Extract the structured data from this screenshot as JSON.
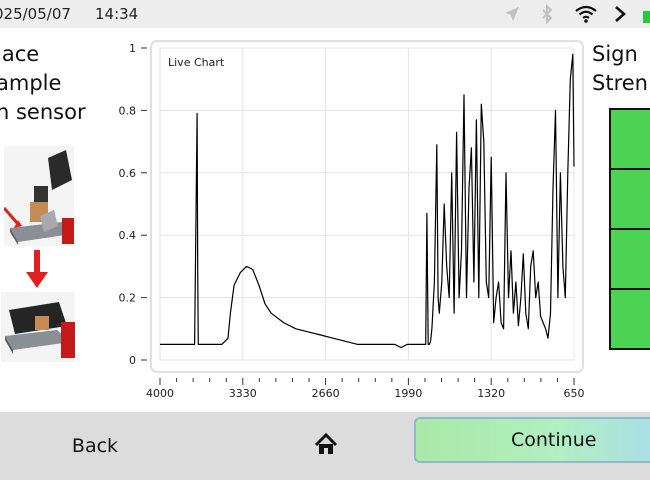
{
  "status_bar": {
    "date": "025/05/07",
    "time": "14:34",
    "icons": [
      "location-icon",
      "bluetooth-icon",
      "wifi-icon",
      "chevron-right-icon",
      "battery-icon"
    ]
  },
  "instructions": {
    "lines": [
      "lace",
      "ample",
      "n sensor"
    ]
  },
  "signal": {
    "title_lines": [
      "Sign",
      "Stren"
    ],
    "bars_filled": 4,
    "bar_color": "#4cd353"
  },
  "bottom_bar": {
    "back_label": "Back",
    "home_icon": "home-icon",
    "continue_label": "Continue"
  },
  "chart_data": {
    "type": "line",
    "title": "Live Chart",
    "xlabel": "",
    "ylabel": "",
    "xlim": [
      4000,
      650
    ],
    "ylim": [
      0,
      1
    ],
    "x_ticks": [
      4000,
      3330,
      2660,
      1990,
      1320,
      650
    ],
    "y_ticks": [
      0,
      0.2,
      0.4,
      0.6,
      0.8,
      1
    ],
    "y_tick_labels": [
      "0",
      "0.2",
      "0.4",
      "0.6",
      "0.8",
      "1"
    ],
    "grid": true,
    "series": [
      {
        "x": [
          4000,
          3900,
          3800,
          3720,
          3700,
          3695,
          3690,
          3680,
          3600,
          3500,
          3450,
          3430,
          3400,
          3350,
          3300,
          3250,
          3200,
          3150,
          3100,
          3000,
          2900,
          2800,
          2700,
          2600,
          2500,
          2400,
          2300,
          2200,
          2150,
          2100,
          2050,
          2000,
          1950,
          1900,
          1850,
          1840,
          1830,
          1825,
          1820,
          1810,
          1800,
          1780,
          1760,
          1750,
          1740,
          1720,
          1700,
          1680,
          1660,
          1640,
          1620,
          1600,
          1580,
          1560,
          1540,
          1520,
          1500,
          1480,
          1460,
          1440,
          1420,
          1400,
          1380,
          1360,
          1340,
          1320,
          1300,
          1280,
          1260,
          1240,
          1220,
          1200,
          1180,
          1160,
          1140,
          1120,
          1100,
          1080,
          1060,
          1040,
          1020,
          1000,
          980,
          960,
          940,
          920,
          900,
          880,
          860,
          840,
          820,
          800,
          780,
          760,
          740,
          720,
          700,
          680,
          660,
          650
        ],
        "y": [
          0.05,
          0.05,
          0.05,
          0.05,
          0.79,
          0.3,
          0.05,
          0.05,
          0.05,
          0.05,
          0.07,
          0.15,
          0.24,
          0.28,
          0.3,
          0.29,
          0.24,
          0.18,
          0.15,
          0.12,
          0.1,
          0.09,
          0.08,
          0.07,
          0.06,
          0.05,
          0.05,
          0.05,
          0.05,
          0.05,
          0.04,
          0.05,
          0.05,
          0.05,
          0.05,
          0.47,
          0.05,
          0.05,
          0.05,
          0.06,
          0.1,
          0.25,
          0.69,
          0.2,
          0.15,
          0.25,
          0.5,
          0.3,
          0.2,
          0.6,
          0.15,
          0.73,
          0.2,
          0.35,
          0.85,
          0.2,
          0.55,
          0.68,
          0.25,
          0.77,
          0.2,
          0.82,
          0.7,
          0.25,
          0.2,
          0.65,
          0.12,
          0.2,
          0.25,
          0.12,
          0.1,
          0.6,
          0.2,
          0.35,
          0.15,
          0.25,
          0.11,
          0.2,
          0.34,
          0.15,
          0.1,
          0.3,
          0.35,
          0.2,
          0.25,
          0.14,
          0.12,
          0.1,
          0.07,
          0.15,
          0.55,
          0.8,
          0.2,
          0.6,
          0.3,
          0.2,
          0.6,
          0.9,
          0.98,
          0.62
        ]
      }
    ]
  }
}
